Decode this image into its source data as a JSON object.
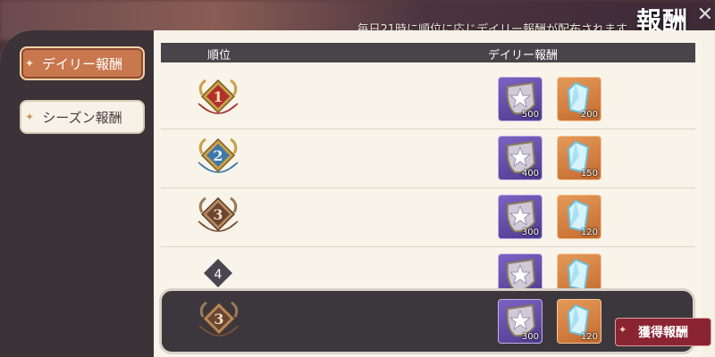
{
  "header_bar": {
    "notice": "毎日21時に順位に応じデイリー報酬が配布されます",
    "title": "報酬",
    "close_glyph": "✕"
  },
  "tabs": [
    {
      "label": "デイリー報酬",
      "active": true
    },
    {
      "label": "シーズン報酬",
      "active": false
    }
  ],
  "table": {
    "col_rank": "順位",
    "col_reward": "デイリー報酬"
  },
  "rows": [
    {
      "rank": "1",
      "star_qty": "500",
      "crystal_qty": "200"
    },
    {
      "rank": "2",
      "star_qty": "400",
      "crystal_qty": "150"
    },
    {
      "rank": "3",
      "star_qty": "300",
      "crystal_qty": "120"
    },
    {
      "rank": "4"
    }
  ],
  "my_row": {
    "rank": "3",
    "star_qty": "300",
    "crystal_qty": "120"
  },
  "claim_button": {
    "label": "獲得報酬"
  },
  "colors": {
    "gold": "#c9a04a",
    "silver_blue": "#3f79a8",
    "bronze": "#7a5137",
    "panel": "#f6f1e6",
    "dark": "#3b373d",
    "claim": "#8a2433"
  },
  "icons": {
    "star": "star-shield-icon",
    "crystal": "crystal-icon",
    "spark": "sparkle-icon"
  }
}
